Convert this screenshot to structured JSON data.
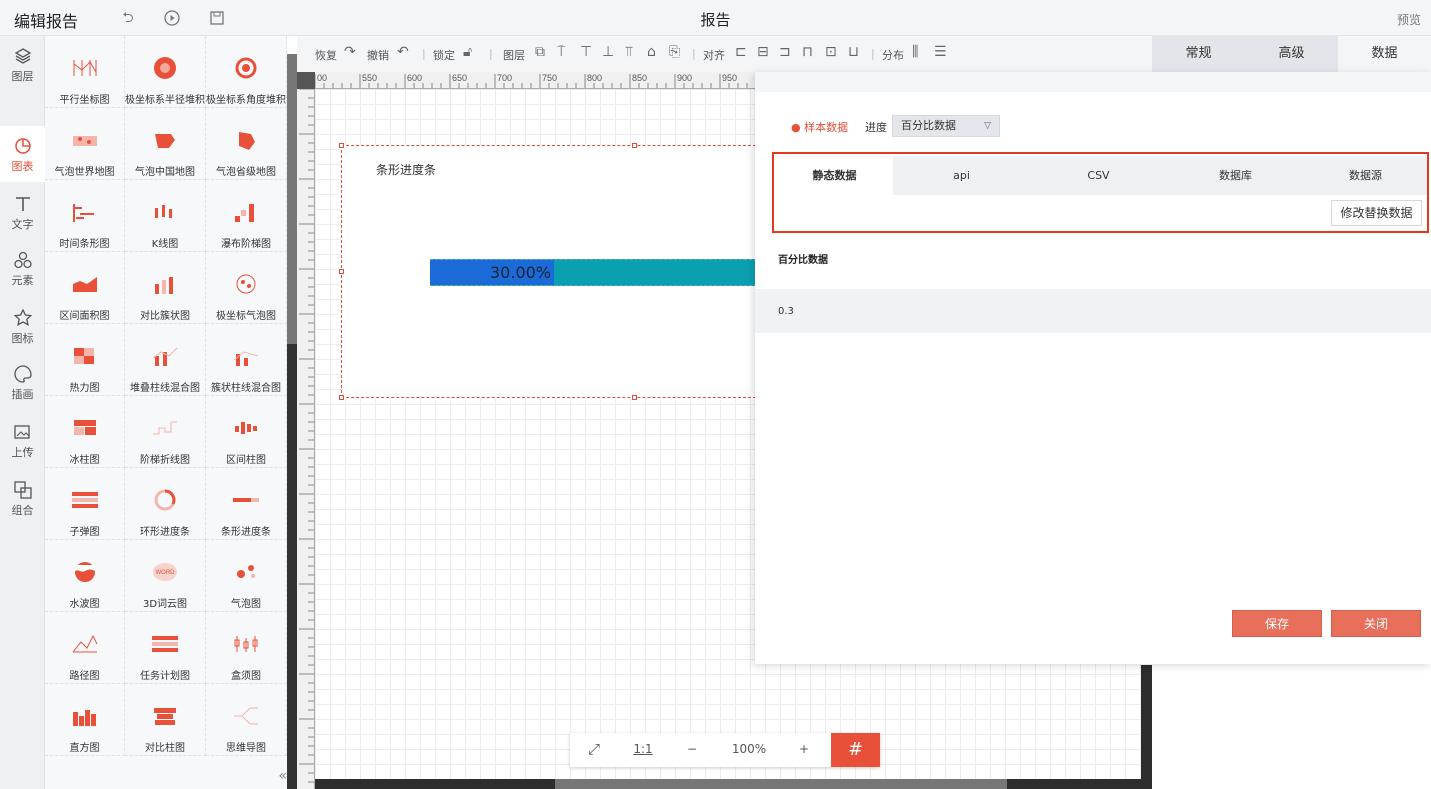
{
  "topbar": {
    "title": "编辑报告",
    "center_title": "报告",
    "preview": "预览"
  },
  "leftnav": [
    {
      "label": "图层",
      "icon": "layers-icon"
    },
    {
      "label": "图表",
      "icon": "chart-icon",
      "active": true
    },
    {
      "label": "文字",
      "icon": "text-icon"
    },
    {
      "label": "元素",
      "icon": "shapes-icon"
    },
    {
      "label": "图标",
      "icon": "star-icon"
    },
    {
      "label": "插画",
      "icon": "palette-icon"
    },
    {
      "label": "上传",
      "icon": "upload-image-icon"
    },
    {
      "label": "组合",
      "icon": "group-icon"
    }
  ],
  "palette": [
    "平行坐标图",
    "极坐标系半径堆积",
    "极坐标系角度堆积",
    "气泡世界地图",
    "气泡中国地图",
    "气泡省级地图",
    "时间条形图",
    "K线图",
    "瀑布阶梯图",
    "区间面积图",
    "对比簇状图",
    "极坐标气泡图",
    "热力图",
    "堆叠柱线混合图",
    "簇状柱线混合图",
    "冰柱图",
    "阶梯折线图",
    "区间柱图",
    "子弹图",
    "环形进度条",
    "条形进度条",
    "水波图",
    "3D词云图",
    "气泡图",
    "路径图",
    "任务计划图",
    "盒须图",
    "直方图",
    "对比柱图",
    "思维导图"
  ],
  "toolbar": {
    "redo": "恢复",
    "undo": "撤销",
    "lock": "锁定",
    "layer": "图层",
    "align": "对齐",
    "distribute": "分布"
  },
  "right_tabs": [
    "常规",
    "高级",
    "数据"
  ],
  "ruler_top": [
    "00",
    "550",
    "600",
    "650",
    "700",
    "750",
    "800",
    "850",
    "900",
    "950"
  ],
  "component": {
    "title": "条形进度条",
    "value": 0.3,
    "value_label": "30.00%",
    "color_fill": "#1a6bd8",
    "color_track": "#0aa0b0"
  },
  "zoom": {
    "fit": "⤢",
    "one": "1:1",
    "minus": "−",
    "level": "100%",
    "plus": "+"
  },
  "data_panel": {
    "sample_label": "样本数据",
    "progress_label": "进度",
    "progress_select": "百分比数据",
    "tabs": [
      "静态数据",
      "api",
      "CSV",
      "数据库",
      "数据源"
    ],
    "modify_button": "修改替换数据",
    "field_label": "百分比数据",
    "field_value": "0.3",
    "save": "保存",
    "close": "关闭"
  },
  "accent_color": "#e8503a"
}
